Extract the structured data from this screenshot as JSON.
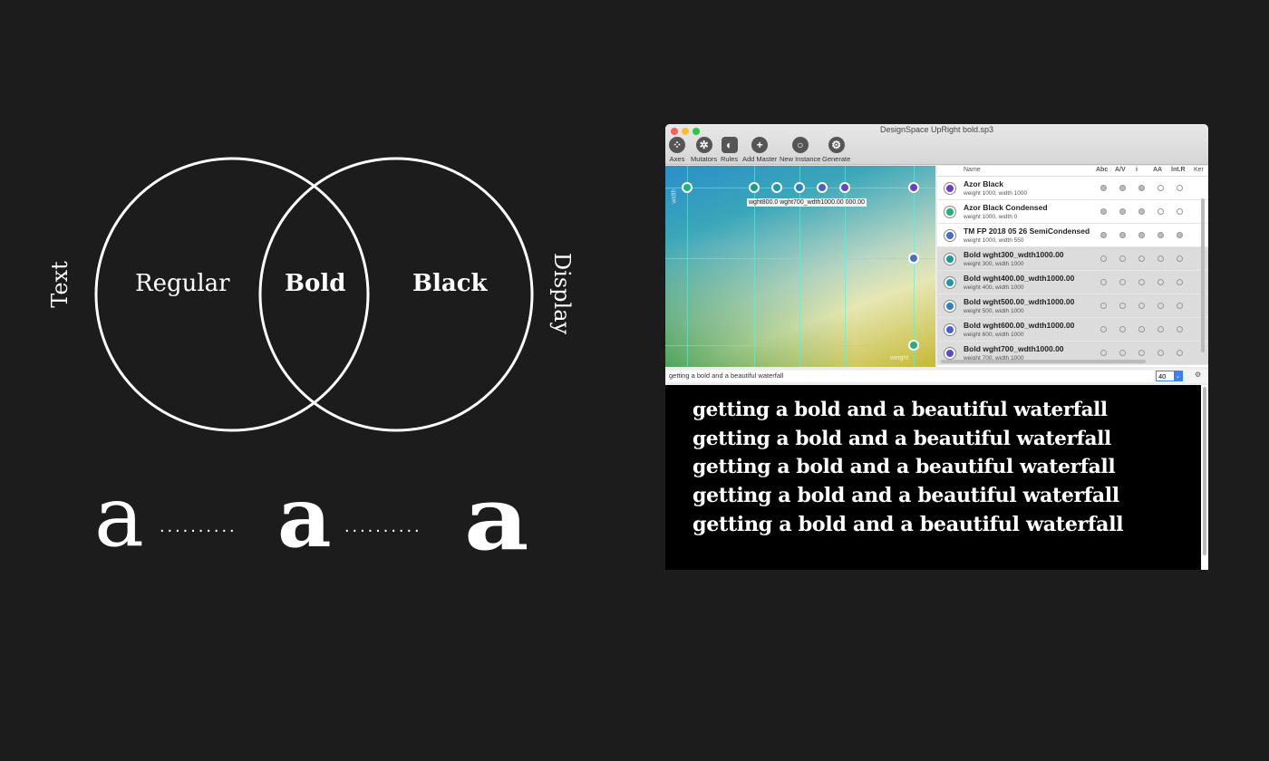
{
  "diagram": {
    "left_axis": "Text",
    "right_axis": "Display",
    "regular": "Regular",
    "bold": "Bold",
    "black": "Black",
    "glyph": "a"
  },
  "window": {
    "title": "DesignSpace UpRight bold.sp3",
    "toolbar": [
      "Axes",
      "Mutators",
      "Rules",
      "Add Master",
      "New Instance",
      "Generate"
    ],
    "canvas": {
      "x_axis": "weight",
      "y_axis": "width",
      "tooltip": "wght800.0 wght700_wdth1000.00 000.00"
    },
    "list": {
      "headers": [
        "Name",
        "Abc",
        "A/V",
        "i",
        "AA",
        "lnt.R",
        "Ker"
      ],
      "rows": [
        {
          "name": "Azor Black",
          "sub": "weight 1000, width 1000",
          "color": "#6a3fc4",
          "icon": "plus",
          "dots": [
            1,
            1,
            1,
            0,
            0
          ]
        },
        {
          "name": "Azor Black Condensed",
          "sub": "weight 1000, width 0",
          "color": "#1fb27a",
          "icon": "plus",
          "dots": [
            1,
            1,
            1,
            0,
            0
          ]
        },
        {
          "name": "TM FP 2018 05 26 SemiCondensed",
          "sub": "weight 1000, width 550",
          "color": "#4a6dc0",
          "icon": "ring",
          "dots": [
            1,
            1,
            1,
            1,
            1
          ]
        },
        {
          "name": "Bold wght300_wdth1000.00",
          "sub": "weight 300, width 1000",
          "color": "#1a9a93",
          "icon": "ring",
          "dots": [
            0,
            0,
            0,
            0,
            0
          ]
        },
        {
          "name": "Bold wght400.00_wdth1000.00",
          "sub": "weight 400, width 1000",
          "color": "#1f97b0",
          "icon": "ring",
          "dots": [
            0,
            0,
            0,
            0,
            0
          ]
        },
        {
          "name": "Bold wght500.00_wdth1000.00",
          "sub": "weight 500, width 1000",
          "color": "#2f7fc4",
          "icon": "ring",
          "dots": [
            0,
            0,
            0,
            0,
            0
          ]
        },
        {
          "name": "Bold wght600.00_wdth1000.00",
          "sub": "weight 600, width 1000",
          "color": "#4a5fc8",
          "icon": "ring",
          "dots": [
            0,
            0,
            0,
            0,
            0
          ]
        },
        {
          "name": "Bold wght700_wdth1000.00",
          "sub": "weight 700, width 1000",
          "color": "#5a4cc8",
          "icon": "ring",
          "dots": [
            0,
            0,
            0,
            0,
            0
          ]
        }
      ]
    },
    "preview_input": "getting a bold and a beautiful waterfall",
    "size_value": "40",
    "waterfall": [
      "getting a bold and a beautiful waterfall",
      "getting a bold and a beautiful waterfall",
      "getting a bold and a beautiful waterfall",
      "getting a bold and a beautiful waterfall",
      "getting a bold and a beautiful waterfall"
    ]
  }
}
